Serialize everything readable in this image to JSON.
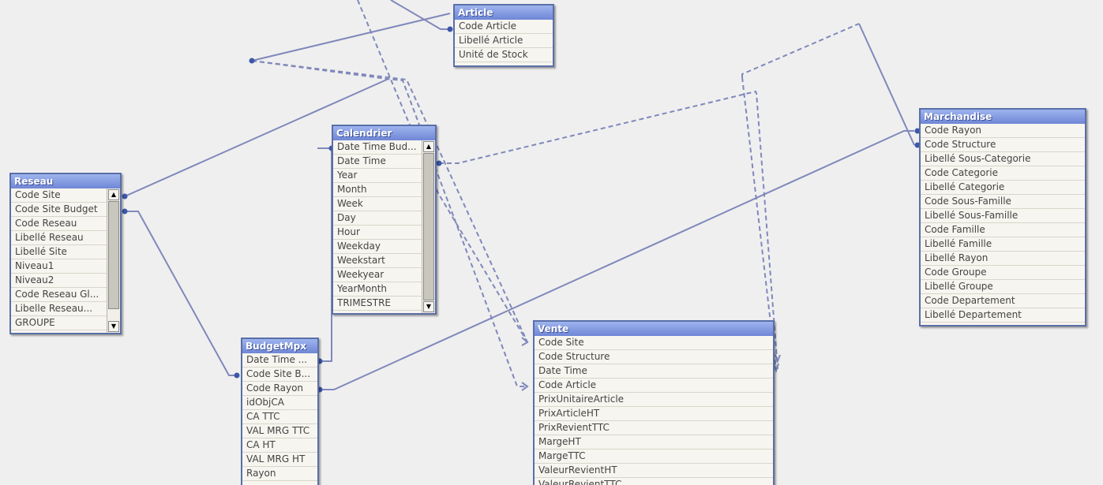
{
  "tables": {
    "article": {
      "title": "Article",
      "fields": [
        "Code Article",
        "Libellé Article",
        "Unité de Stock"
      ]
    },
    "calendrier": {
      "title": "Calendrier",
      "fields": [
        "Date Time Bud...",
        "Date Time",
        "Year",
        "Month",
        "Week",
        "Day",
        "Hour",
        "Weekday",
        "Weekstart",
        "Weekyear",
        "YearMonth",
        "TRIMESTRE"
      ]
    },
    "reseau": {
      "title": "Reseau",
      "fields": [
        "Code Site",
        "Code Site Budget",
        "Code Reseau",
        "Libellé Reseau",
        "Libellé Site",
        "Niveau1",
        "Niveau2",
        "Code Reseau Gl...",
        "Libelle Reseau...",
        "GROUPE"
      ]
    },
    "budgetmpx": {
      "title": "BudgetMpx",
      "fields": [
        "Date Time ...",
        "Code Site B...",
        "Code Rayon",
        "idObjCA",
        "CA TTC",
        "VAL MRG TTC",
        "CA HT",
        "VAL MRG HT",
        "Rayon"
      ]
    },
    "vente": {
      "title": "Vente",
      "fields": [
        "Code Site",
        "Code Structure",
        "Date Time",
        "Code Article",
        "PrixUnitaireArticle",
        "PrixArticleHT",
        "PrixRevientTTC",
        "MargeHT",
        "MargeTTC",
        "ValeurRevientHT",
        "ValeurRevientTTC"
      ]
    },
    "marchandise": {
      "title": "Marchandise",
      "fields": [
        "Code Rayon",
        "Code Structure",
        "Libellé Sous-Categorie",
        "Code Categorie",
        "Libellé Categorie",
        "Code Sous-Famille",
        "Libellé Sous-Famille",
        "Code Famille",
        "Libellé Famille",
        "Libellé Rayon",
        "Code Groupe",
        "Libellé Groupe",
        "Code Departement",
        "Libellé Departement"
      ]
    }
  },
  "colors": {
    "link": "#8088bb",
    "title_bar": "#7b90dc",
    "table_bg": "#f7f5ef",
    "background": "#efefef"
  },
  "icons": {
    "scroll_up": "▲",
    "scroll_down": "▼"
  }
}
